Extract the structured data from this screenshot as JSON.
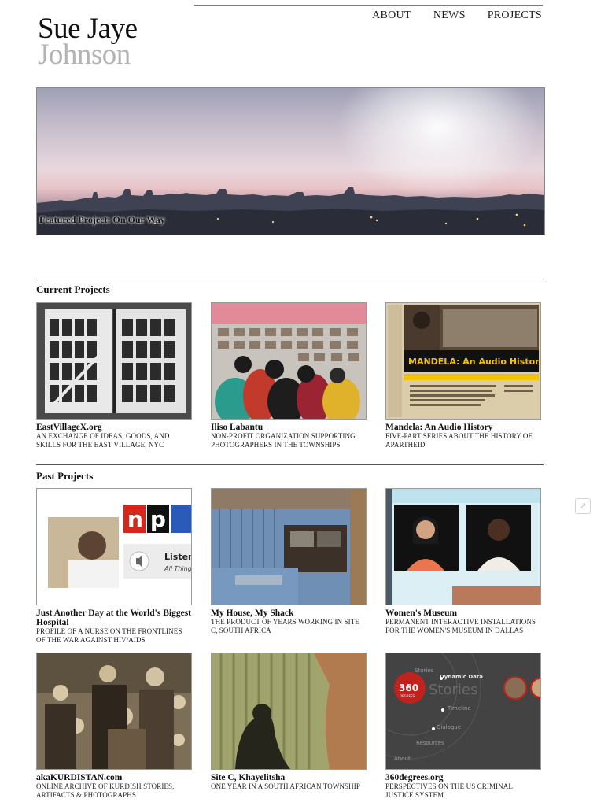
{
  "logo": {
    "line1": "Sue Jaye",
    "line2": "Johnson"
  },
  "nav": [
    "ABOUT",
    "NEWS",
    "PROJECTS"
  ],
  "hero": {
    "caption": "Featured Project: On Our Way"
  },
  "sections": {
    "current": "Current Projects",
    "past": "Past Projects"
  },
  "current_projects": [
    {
      "name": "EastVillageX.org",
      "desc": "AN EXCHANGE OF IDEAS, GOODS, AND SKILLS FOR THE EAST VILLAGE, NYC"
    },
    {
      "name": "Iliso Labantu",
      "desc": "NON-PROFIT ORGANIZATION SUPPORTING PHOTOGRAPHERS IN THE TOWNSHIPS"
    },
    {
      "name": "Mandela: An Audio History",
      "desc": "FIVE-PART SERIES ABOUT THE HISTORY OF APARTHEID"
    }
  ],
  "past_projects": [
    {
      "name": "Just Another Day at the World's Biggest Hospital",
      "desc": "PROFILE OF A NURSE ON THE FRONTLINES OF THE WAR AGAINST HIV/AIDS"
    },
    {
      "name": "My House, My Shack",
      "desc": "THE PRODUCT OF YEARS WORKING IN SITE C, SOUTH AFRICA"
    },
    {
      "name": "Women's Museum",
      "desc": "PERMANENT INTERACTIVE INSTALLATIONS FOR THE WOMEN'S MUSEUM IN DALLAS"
    },
    {
      "name": "akaKURDISTAN.com",
      "desc": "ONLINE ARCHIVE OF KURDISH STORIES, ARTIFACTS & PHOTOGRAPHS"
    },
    {
      "name": "Site C, Khayelitsha",
      "desc": "ONE YEAR IN A SOUTH AFRICAN TOWNSHIP"
    },
    {
      "name": "360degrees.org",
      "desc": "PERSPECTIVES ON THE US CRIMINAL JUSTICE SYSTEM"
    }
  ],
  "thumb_text": {
    "mandela_title": "MANDELA: An Audio History",
    "npr": "np",
    "npr_listen": "Listen",
    "npr_sub": "All Things",
    "s360_logo": "360",
    "s360_logo_sub": "DEGREES",
    "s360_stories": "Stories",
    "s360_stories_small": "Stories",
    "s360_dynamic": "Dynamic Data",
    "s360_timeline": "Timeline",
    "s360_dialogue": "Dialogue",
    "s360_resources": "Resources",
    "s360_about": "About"
  },
  "colors": {
    "accent_npr_red": "#d6271b",
    "mandela_yellow": "#f2c400"
  },
  "icons": {
    "side": "share-icon"
  }
}
